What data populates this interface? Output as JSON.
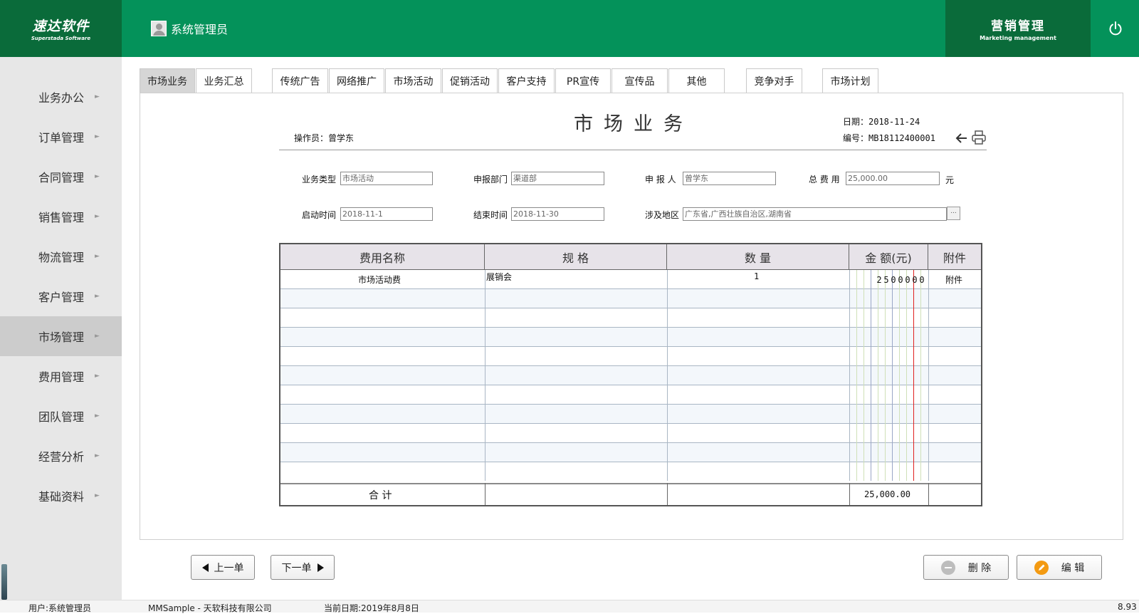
{
  "header": {
    "logo_cn": "速达软件",
    "logo_en": "Superstada Software",
    "user": "系统管理员",
    "module_cn": "营销管理",
    "module_en": "Marketing management"
  },
  "sidebar": {
    "items": [
      {
        "label": "业务办公"
      },
      {
        "label": "订单管理"
      },
      {
        "label": "合同管理"
      },
      {
        "label": "销售管理"
      },
      {
        "label": "物流管理"
      },
      {
        "label": "客户管理"
      },
      {
        "label": "市场管理"
      },
      {
        "label": "费用管理"
      },
      {
        "label": "团队管理"
      },
      {
        "label": "经营分析"
      },
      {
        "label": "基础资料"
      }
    ],
    "arrow": "►"
  },
  "tabs": [
    {
      "label": "市场业务"
    },
    {
      "label": "业务汇总"
    },
    {
      "label": "传统广告"
    },
    {
      "label": "网络推广"
    },
    {
      "label": "市场活动"
    },
    {
      "label": "促销活动"
    },
    {
      "label": "客户支持"
    },
    {
      "label": "PR宣传"
    },
    {
      "label": "宣传品"
    },
    {
      "label": "其他"
    },
    {
      "label": "竞争对手"
    },
    {
      "label": "市场计划"
    }
  ],
  "document": {
    "title": "市场业务",
    "operator": "操作员：曾学东",
    "date": "日期：2018-11-24",
    "number": "编号：MB18112400001"
  },
  "form": {
    "business_type_label": "业务类型",
    "business_type_value": "市场活动",
    "department_label": "申报部门",
    "department_value": "渠道部",
    "applicant_label": "申 报 人",
    "applicant_value": "曾学东",
    "total_cost_label": "总 费 用",
    "total_cost_value": "25,000.00",
    "total_cost_unit": "元",
    "start_label": "启动时间",
    "start_value": "2018-11-1",
    "end_label": "结束时间",
    "end_value": "2018-11-30",
    "region_label": "涉及地区",
    "region_value": "广东省,广西壮族自治区,湖南省",
    "browse_label": "..."
  },
  "grid": {
    "headers": [
      "费用名称",
      "规 格",
      "数 量",
      "金 额(元)",
      "附件"
    ],
    "rows": [
      {
        "name": "市场活动费",
        "spec": "展销会",
        "qty": "1",
        "amount_digits": [
          "2",
          "5",
          "0",
          "0",
          "0",
          "0",
          "0"
        ],
        "attachment": "附件"
      }
    ],
    "total_label": "合 计",
    "total_amount": "25,000.00"
  },
  "buttons": {
    "prev": "上一单",
    "next": "下一单",
    "delete": "删 除",
    "edit": "编 辑"
  },
  "status": {
    "user": "用户:系统管理员",
    "company": "MMSample - 天软科技有限公司",
    "date": "当前日期:2019年8月8日",
    "version": "8.93"
  },
  "colors": {
    "header_green": "#04925a",
    "dark_green": "#0a6b3a",
    "sidebar_bg": "#e7e7e7",
    "active_item": "#cccccc",
    "edit_orange": "#f39a12",
    "decimal_red": "#e02020"
  }
}
